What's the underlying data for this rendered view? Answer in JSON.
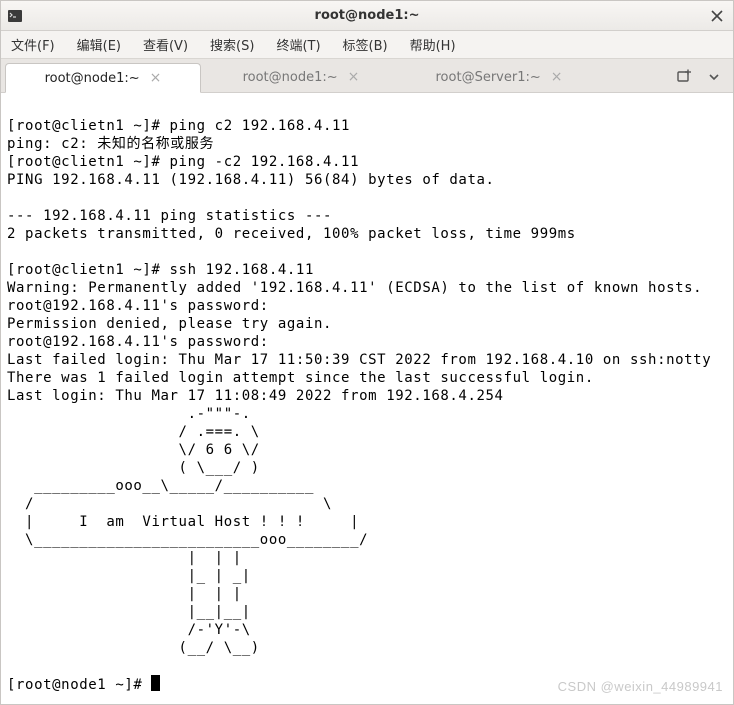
{
  "window": {
    "title": "root@node1:~"
  },
  "menubar": {
    "items": [
      {
        "label": "文件(F)",
        "key": "file"
      },
      {
        "label": "编辑(E)",
        "key": "edit"
      },
      {
        "label": "查看(V)",
        "key": "view"
      },
      {
        "label": "搜索(S)",
        "key": "search"
      },
      {
        "label": "终端(T)",
        "key": "terminal"
      },
      {
        "label": "标签(B)",
        "key": "tabs"
      },
      {
        "label": "帮助(H)",
        "key": "help"
      }
    ]
  },
  "tabs": [
    {
      "label": "root@node1:~",
      "key": "node1a",
      "active": true
    },
    {
      "label": "root@node1:~",
      "key": "node1b",
      "active": false
    },
    {
      "label": "root@Server1:~",
      "key": "server1",
      "active": false
    }
  ],
  "terminal": {
    "lines": [
      "[root@clietn1 ~]# ping c2 192.168.4.11",
      "ping: c2: 未知的名称或服务",
      "[root@clietn1 ~]# ping -c2 192.168.4.11",
      "PING 192.168.4.11 (192.168.4.11) 56(84) bytes of data.",
      "",
      "--- 192.168.4.11 ping statistics ---",
      "2 packets transmitted, 0 received, 100% packet loss, time 999ms",
      "",
      "[root@clietn1 ~]# ssh 192.168.4.11",
      "Warning: Permanently added '192.168.4.11' (ECDSA) to the list of known hosts.",
      "root@192.168.4.11's password:",
      "Permission denied, please try again.",
      "root@192.168.4.11's password:",
      "Last failed login: Thu Mar 17 11:50:39 CST 2022 from 192.168.4.10 on ssh:notty",
      "There was 1 failed login attempt since the last successful login.",
      "Last login: Thu Mar 17 11:08:49 2022 from 192.168.4.254",
      "                    .-\"\"\"-.",
      "                   / .===. \\",
      "                   \\/ 6 6 \\/",
      "                   ( \\___/ )",
      "   _________ooo__\\_____/__________",
      "  /                                \\",
      "  |     I  am  Virtual Host ! ! !     |",
      "  \\_________________________ooo________/",
      "                    |  | |",
      "                    |_ | _|",
      "                    |  | |",
      "                    |__|__|",
      "                    /-'Y'-\\",
      "                   (__/ \\__)",
      ""
    ],
    "prompt": "[root@node1 ~]# "
  },
  "watermark": "CSDN @weixin_44989941"
}
